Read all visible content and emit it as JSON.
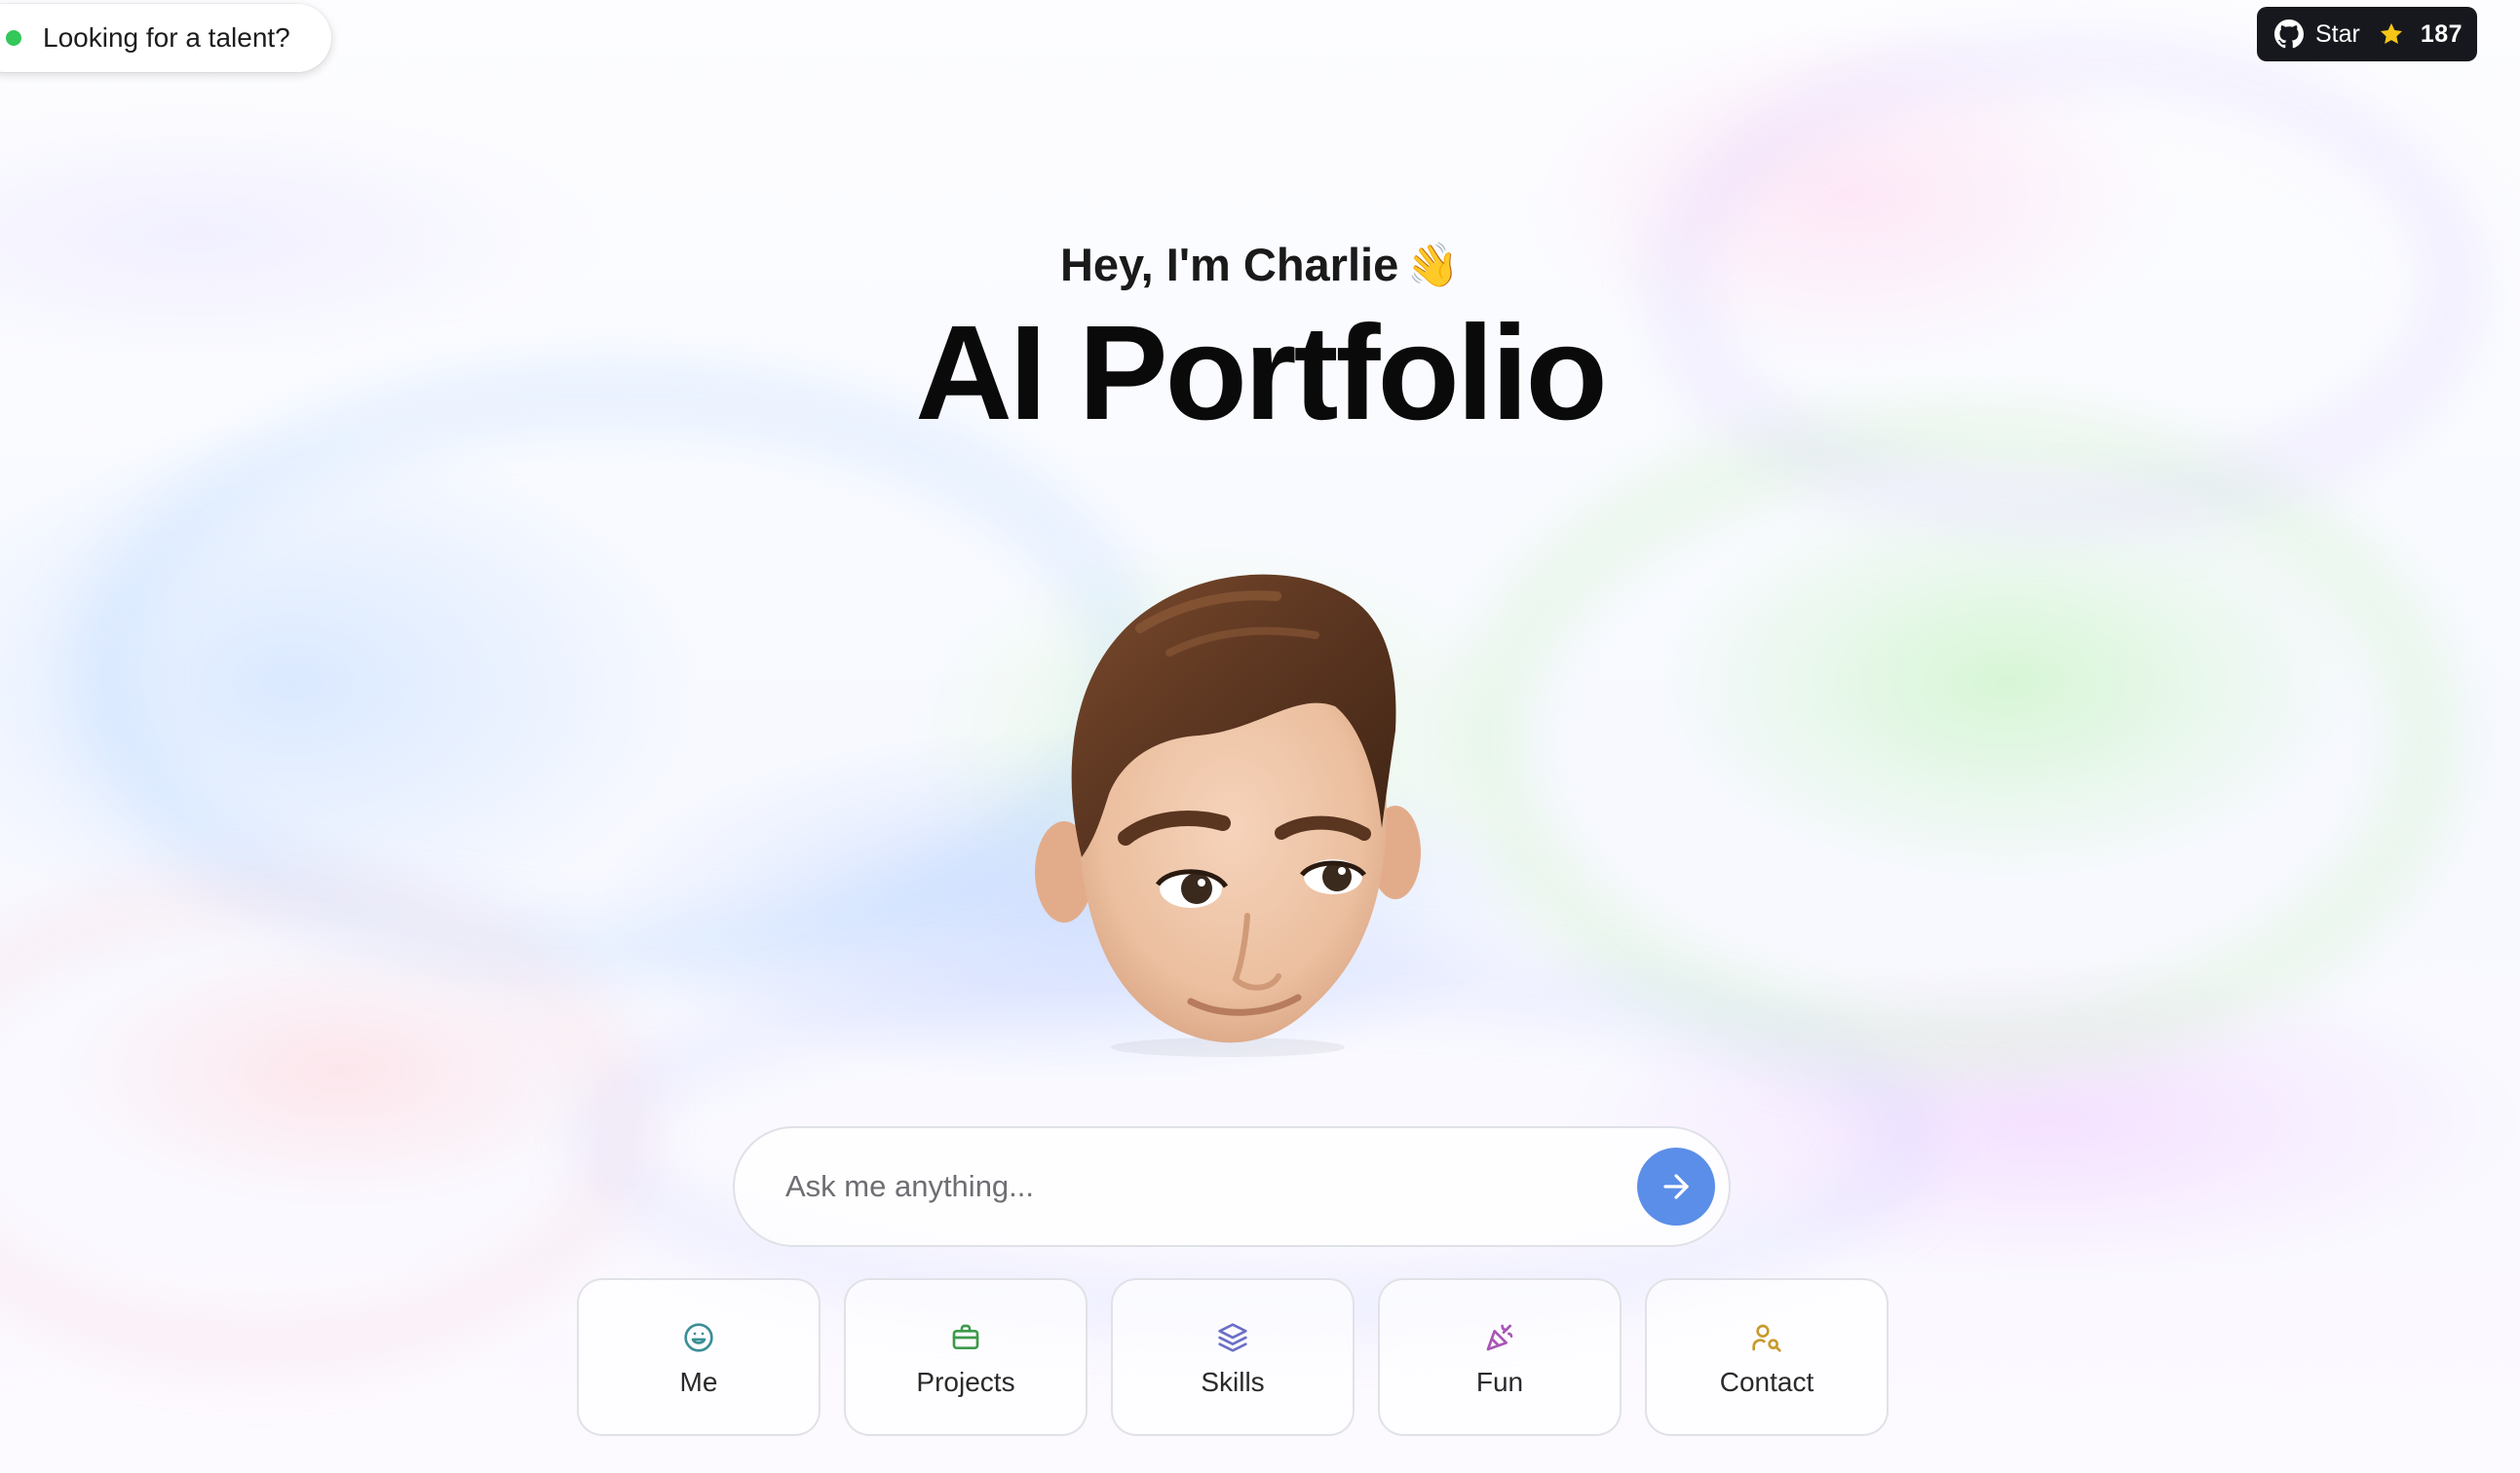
{
  "badge": {
    "label": "Looking for a talent?",
    "status_color": "#34c759"
  },
  "github": {
    "icon": "github-icon",
    "star_label": "Star",
    "star_icon": "star-icon",
    "star_count": "187"
  },
  "hero": {
    "greeting": "Hey, I'm Charlie",
    "greeting_emoji": "👋",
    "title": "AI Portfolio",
    "avatar": "memoji-avatar"
  },
  "chat": {
    "placeholder": "Ask me anything...",
    "send_icon": "arrow-right-icon",
    "send_color": "#5b8ee8"
  },
  "quick_actions": [
    {
      "label": "Me",
      "icon": "smile-icon",
      "color": "#3a8f95"
    },
    {
      "label": "Projects",
      "icon": "briefcase-icon",
      "color": "#3c9a4b"
    },
    {
      "label": "Skills",
      "icon": "layers-icon",
      "color": "#6b6fc6"
    },
    {
      "label": "Fun",
      "icon": "party-popper-icon",
      "color": "#a855b5"
    },
    {
      "label": "Contact",
      "icon": "user-search-icon",
      "color": "#c79a2a"
    }
  ]
}
